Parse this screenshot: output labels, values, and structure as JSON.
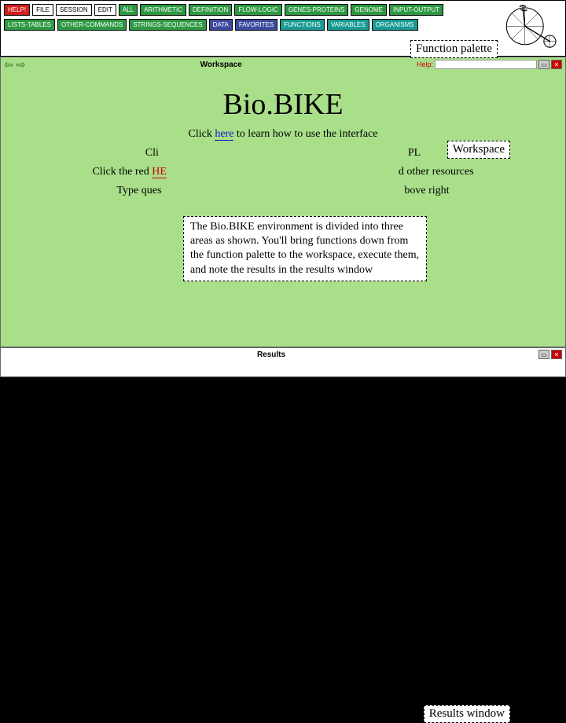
{
  "palette": {
    "row1": [
      {
        "label": "HELP!",
        "cls": "red-btn"
      },
      {
        "label": "FILE",
        "cls": "white-btn"
      },
      {
        "label": "SESSION",
        "cls": "white-btn"
      },
      {
        "label": "EDIT",
        "cls": "white-btn"
      },
      {
        "label": "ALL",
        "cls": "green-btn"
      },
      {
        "label": "ARITHMETIC",
        "cls": "green-btn"
      },
      {
        "label": "DEFINITION",
        "cls": "green-btn"
      },
      {
        "label": "FLOW-LOGIC",
        "cls": "green-btn"
      },
      {
        "label": "GENES-PROTEINS",
        "cls": "green-btn"
      },
      {
        "label": "GENOME",
        "cls": "green-btn"
      },
      {
        "label": "INPUT-OUTPUT",
        "cls": "green-btn"
      }
    ],
    "row2": [
      {
        "label": "LISTS-TABLES",
        "cls": "green-btn"
      },
      {
        "label": "OTHER-COMMANDS",
        "cls": "green-btn"
      },
      {
        "label": "STRINGS-SEQUENCES",
        "cls": "green-btn"
      },
      {
        "label": "DATA",
        "cls": "blue-btn"
      },
      {
        "label": "FAVORITES",
        "cls": "blue-btn"
      },
      {
        "label": "FUNCTIONS",
        "cls": "teal-btn"
      },
      {
        "label": "VARIABLES",
        "cls": "teal-btn"
      },
      {
        "label": "ORGANISMS",
        "cls": "teal-btn"
      }
    ]
  },
  "labels": {
    "function_palette": "Function palette",
    "workspace": "Workspace",
    "results_window": "Results window"
  },
  "workspace": {
    "title": "Workspace",
    "help": "Help:",
    "search_placeholder": ""
  },
  "content": {
    "logo": "Bio.BIKE",
    "line1_a": "Click ",
    "line1_link": "here",
    "line1_b": " to learn how to use the interface",
    "line2_a": "Cli",
    "line2_b": "PL",
    "line3_a": "Click the red ",
    "line3_help": "HE",
    "line3_b": "d other resources",
    "line4_a": "Type ques",
    "line4_b": "bove right"
  },
  "callout": "The Bio.BIKE environment is divided into three areas as shown. You'll bring functions down from the function palette to the workspace, execute them, and note the results in the results window",
  "results": {
    "title": "Results"
  }
}
